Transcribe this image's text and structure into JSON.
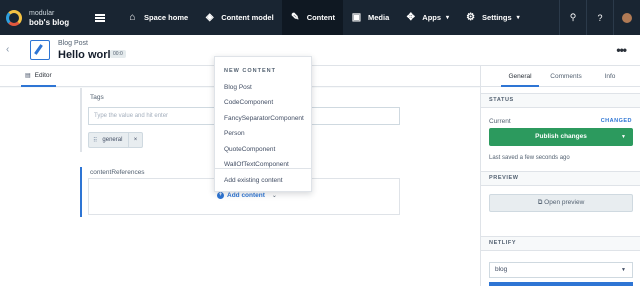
{
  "colors": {
    "topnav": "#192532",
    "accent": "#2e75d4",
    "publish": "#2c9a5e"
  },
  "topnav": {
    "org": "modular",
    "space": "bob's blog",
    "items": [
      {
        "label": "Space home",
        "icon": "home-icon"
      },
      {
        "label": "Content model",
        "icon": "cube-icon"
      },
      {
        "label": "Content",
        "icon": "edit-icon",
        "active": true
      },
      {
        "label": "Media",
        "icon": "image-icon"
      },
      {
        "label": "Apps",
        "icon": "puzzle-icon",
        "caret": "▾"
      },
      {
        "label": "Settings",
        "icon": "gear-icon",
        "caret": "▾"
      }
    ]
  },
  "entry": {
    "type": "Blog Post",
    "title": "Hello world",
    "badge": "00:0"
  },
  "editor_tab": {
    "label": "Editor"
  },
  "fields": {
    "tags": {
      "label": "Tags",
      "placeholder": "Type the value and hit enter",
      "pill": "general"
    },
    "refs": {
      "label": "contentReferences",
      "add_label": "Add content"
    }
  },
  "dropdown": {
    "heading": "NEW CONTENT",
    "items": [
      "Blog Post",
      "CodeComponent",
      "FancySeparatorComponent",
      "Person",
      "QuoteComponent",
      "WallOfTextComponent"
    ],
    "existing": "Add existing content"
  },
  "sidebar": {
    "tabs": [
      "General",
      "Comments",
      "Info"
    ],
    "status_heading": "STATUS",
    "current": "Current",
    "changed": "CHANGED",
    "publish": "Publish changes",
    "saved": "Last saved a few seconds ago",
    "preview_heading": "PREVIEW",
    "open_preview": "Open preview",
    "netlify_heading": "NETLIFY",
    "netlify_value": "blog"
  }
}
